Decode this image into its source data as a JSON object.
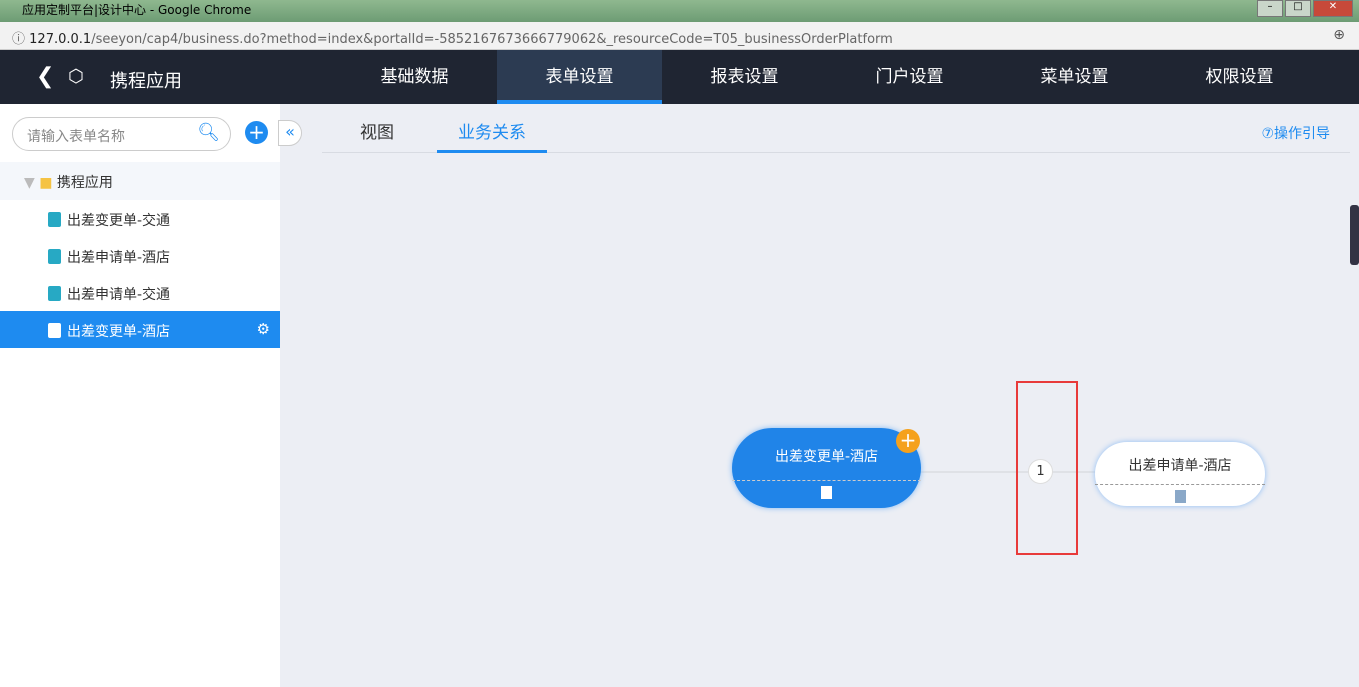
{
  "window": {
    "title": "应用定制平台|设计中心 - Google Chrome",
    "url_host": "127.0.0.1",
    "url_path": "/seeyon/cap4/business.do?method=index&portalId=-5852167673666779062&_resourceCode=T05_businessOrderPlatform"
  },
  "header": {
    "app_name": "携程应用",
    "tabs": [
      {
        "label": "基础数据"
      },
      {
        "label": "表单设置"
      },
      {
        "label": "报表设置"
      },
      {
        "label": "门户设置"
      },
      {
        "label": "菜单设置"
      },
      {
        "label": "权限设置"
      }
    ]
  },
  "sidebar": {
    "search_placeholder": "请输入表单名称",
    "folder": "携程应用",
    "items": [
      {
        "label": "出差变更单-交通"
      },
      {
        "label": "出差申请单-酒店"
      },
      {
        "label": "出差申请单-交通"
      },
      {
        "label": "出差变更单-酒店"
      }
    ]
  },
  "main": {
    "tabs": [
      {
        "label": "视图"
      },
      {
        "label": "业务关系"
      }
    ],
    "guide": "⑦操作引导",
    "source_node": "出差变更单-酒店",
    "target_node": "出差申请单-酒店",
    "relation_count": "1"
  }
}
